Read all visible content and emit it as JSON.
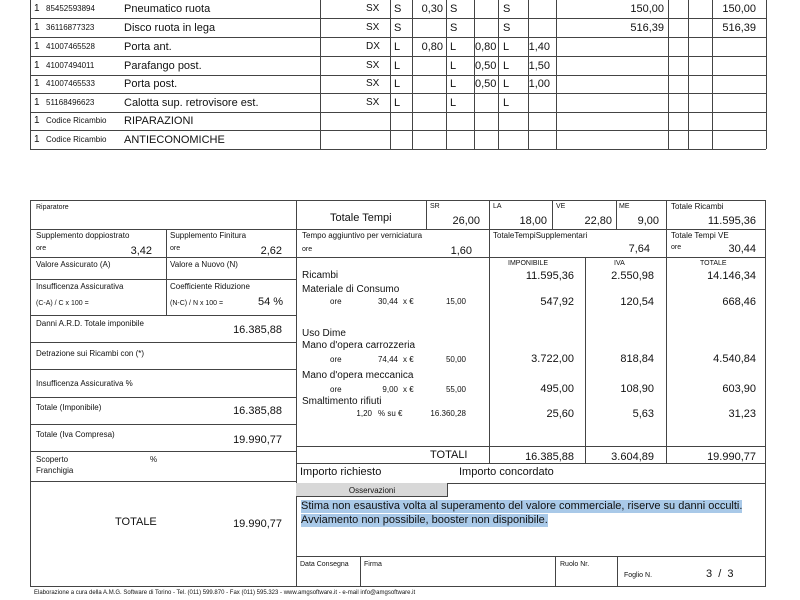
{
  "parts_rows": [
    {
      "qty": "1",
      "code": "85452593894",
      "desc": "Pneumatico ruota",
      "side": "SX",
      "c1": "S",
      "c2": "0,30",
      "c3": "S",
      "c4": "",
      "c5": "S",
      "c6": "",
      "price": "150,00",
      "total": "150,00"
    },
    {
      "qty": "1",
      "code": "36116877323",
      "desc": "Disco ruota in lega",
      "side": "SX",
      "c1": "S",
      "c2": "",
      "c3": "S",
      "c4": "",
      "c5": "S",
      "c6": "",
      "price": "516,39",
      "total": "516,39"
    },
    {
      "qty": "1",
      "code": "41007465528",
      "desc": "Porta ant.",
      "side": "DX",
      "c1": "L",
      "c2": "0,80",
      "c3": "L",
      "c4": "0,80",
      "c5": "L",
      "c6": "1,40",
      "price": "",
      "total": ""
    },
    {
      "qty": "1",
      "code": "41007494011",
      "desc": "Parafango post.",
      "side": "SX",
      "c1": "L",
      "c2": "",
      "c3": "L",
      "c4": "0,50",
      "c5": "L",
      "c6": "1,50",
      "price": "",
      "total": ""
    },
    {
      "qty": "1",
      "code": "41007465533",
      "desc": "Porta post.",
      "side": "SX",
      "c1": "L",
      "c2": "",
      "c3": "L",
      "c4": "0,50",
      "c5": "L",
      "c6": "1,00",
      "price": "",
      "total": ""
    },
    {
      "qty": "1",
      "code": "51168496623",
      "desc": "Calotta sup. retrovisore est.",
      "side": "SX",
      "c1": "L",
      "c2": "",
      "c3": "L",
      "c4": "",
      "c5": "L",
      "c6": "",
      "price": "",
      "total": ""
    },
    {
      "qty": "1",
      "code": "Codice Ricambio",
      "desc": "RIPARAZIONI",
      "side": "",
      "c1": "",
      "c2": "",
      "c3": "",
      "c4": "",
      "c5": "",
      "c6": "",
      "price": "",
      "total": ""
    },
    {
      "qty": "1",
      "code": "Codice Ricambio",
      "desc": "ANTIECONOMICHE",
      "side": "",
      "c1": "",
      "c2": "",
      "c3": "",
      "c4": "",
      "c5": "",
      "c6": "",
      "price": "",
      "total": ""
    }
  ],
  "left": {
    "riparatore": "Riparatore",
    "supp_dopp_label": "Supplemento doppiostrato",
    "supp_dopp_unit": "ore",
    "supp_dopp_val": "3,42",
    "supp_fin_label": "Supplemento Finitura",
    "supp_fin_unit": "ore",
    "supp_fin_val": "2,62",
    "val_ass": "Valore Assicurato (A)",
    "val_nuovo": "Valore a Nuovo (N)",
    "insuff_label": "Insufficenza Assicurativa",
    "insuff_formula": "(C-A) / C x 100 =",
    "coeff_label": "Coefficiente Riduzione",
    "coeff_formula": "(N-C) / N x 100 =",
    "coeff_val": "54 %",
    "danni_label": "Danni A.R.D. Totale imponibile",
    "danni_val": "16.385,88",
    "detr_label": "Detrazione sui Ricambi con (*)",
    "insuff_pct_label": "Insufficenza Assicurativa %",
    "tot_imp_label": "Totale (Imponibile)",
    "tot_imp_val": "16.385,88",
    "tot_iva_label": "Totale (Iva Compresa)",
    "tot_iva_val": "19.990,77",
    "scoperto_label": "Scoperto",
    "scoperto_pct": "%",
    "franchigia_label": "Franchigia",
    "totale_label": "TOTALE",
    "totale_val": "19.990,77"
  },
  "times": {
    "totale_tempi": "Totale Tempi",
    "sr_label": "SR",
    "sr_val": "26,00",
    "la_label": "LA",
    "la_val": "18,00",
    "ve_label": "VE",
    "ve_val": "22,80",
    "me_label": "ME",
    "me_val": "9,00",
    "tot_ric_label": "Totale Ricambi",
    "tot_ric_val": "11.595,36",
    "tempo_label": "Tempo aggiuntivo per verniciatura",
    "tempo_unit": "ore",
    "tempo_val": "1,60",
    "tts_label": "TotaleTempiSupplementari",
    "tts_val": "7,64",
    "ttve_label": "Totale Tempi VE",
    "ttve_unit": "ore",
    "ttve_val": "30,44"
  },
  "costs": {
    "imponibile_h": "IMPONIBILE",
    "iva_h": "IVA",
    "totale_h": "TOTALE",
    "ricambi": {
      "label": "Ricambi",
      "imp": "11.595,36",
      "iva": "2.550,98",
      "tot": "14.146,34"
    },
    "materiale": {
      "label": "Materiale di Consumo",
      "unit": "ore",
      "hours": "30,44",
      "x": "x €",
      "rate": "15,00",
      "imp": "547,92",
      "iva": "120,54",
      "tot": "668,46"
    },
    "uso_dime": "Uso Dime",
    "carrozzeria": {
      "label": "Mano d'opera carrozzeria",
      "unit": "ore",
      "hours": "74,44",
      "x": "x €",
      "rate": "50,00",
      "imp": "3.722,00",
      "iva": "818,84",
      "tot": "4.540,84"
    },
    "meccanica": {
      "label": "Mano d'opera meccanica",
      "unit": "ore",
      "hours": "9,00",
      "x": "x €",
      "rate": "55,00",
      "imp": "495,00",
      "iva": "108,90",
      "tot": "603,90"
    },
    "rifiuti": {
      "label": "Smaltimento rifiuti",
      "pct": "1,20",
      "x": "% su €",
      "base": "16.360,28",
      "imp": "25,60",
      "iva": "5,63",
      "tot": "31,23"
    },
    "totali": {
      "label": "TOTALI",
      "imp": "16.385,88",
      "iva": "3.604,89",
      "tot": "19.990,77"
    }
  },
  "importo_richiesto": "Importo richiesto",
  "importo_concordato": "Importo concordato",
  "osservazioni_label": "Osservazioni",
  "osservazioni_line1": "Stima non esaustiva volta al superamento del valore commerciale, riserve su danni occulti.",
  "osservazioni_line2": "Avviamento non possibile, booster non disponibile.",
  "data_consegna": "Data Consegna",
  "firma": "Firma",
  "ruolo": "Ruolo Nr.",
  "foglio_label": "Foglio N.",
  "foglio_val": "3  /  3",
  "footer": "Elaborazione a cura della A.M.G. Software di Torino - Tel. (011) 599.870 - Fax (011) 595.323 - www.amgsoftware.it - e-mail info@amgsoftware.it"
}
